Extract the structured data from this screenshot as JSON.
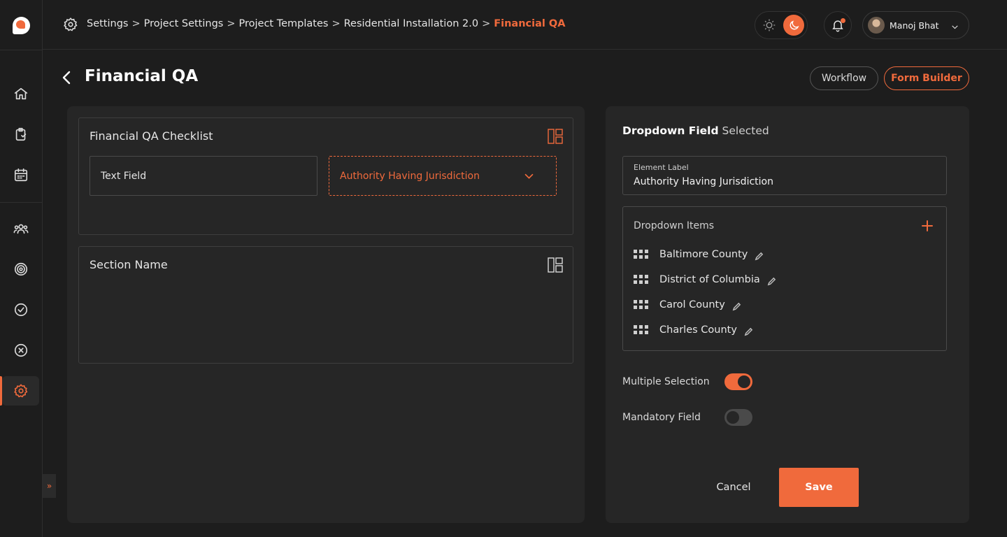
{
  "app": {
    "logo_icon": "app-logo"
  },
  "sidebar": {
    "items": [
      {
        "name": "home",
        "icon": "home-icon"
      },
      {
        "name": "clipboard",
        "icon": "clipboard-icon"
      },
      {
        "name": "calendar",
        "icon": "calendar-icon"
      },
      {
        "name": "team",
        "icon": "team-icon"
      },
      {
        "name": "target",
        "icon": "target-icon"
      },
      {
        "name": "approved",
        "icon": "check-circle-icon"
      },
      {
        "name": "rejected",
        "icon": "x-circle-icon"
      },
      {
        "name": "settings",
        "icon": "gear-icon",
        "active": true
      }
    ],
    "expand_glyph": "»"
  },
  "breadcrumb": {
    "items": [
      "Settings",
      "Project Settings",
      "Project Templates",
      "Residential Installation 2.0"
    ],
    "current": "Financial QA",
    "separator": ">"
  },
  "header": {
    "user_name": "Manoj Bhat",
    "theme": "dark",
    "has_notification": true
  },
  "page": {
    "title": "Financial QA",
    "tabs": [
      {
        "label": "Workflow",
        "active": false
      },
      {
        "label": "Form Builder",
        "active": true
      }
    ]
  },
  "canvas": {
    "sections": [
      {
        "title": "Financial QA Checklist",
        "fields": [
          {
            "label": "Text Field",
            "type": "text"
          },
          {
            "label": "Authority Having Jurisdiction",
            "type": "dropdown",
            "selected": true
          }
        ]
      },
      {
        "title": "Section Name",
        "fields": []
      }
    ]
  },
  "properties": {
    "heading_type": "Dropdown Field",
    "heading_state": "Selected",
    "element_label_caption": "Element Label",
    "element_label_value": "Authority Having Jurisdiction",
    "dropdown_items_caption": "Dropdown Items",
    "dropdown_items": [
      "Baltimore County",
      "District of Columbia",
      "Carol County",
      "Charles County"
    ],
    "multiple_selection_label": "Multiple Selection",
    "multiple_selection_on": true,
    "mandatory_field_label": "Mandatory Field",
    "mandatory_field_on": false,
    "cancel_label": "Cancel",
    "save_label": "Save"
  },
  "colors": {
    "accent": "#f06a3c",
    "background": "#1d1d1d",
    "panel": "#262626"
  }
}
